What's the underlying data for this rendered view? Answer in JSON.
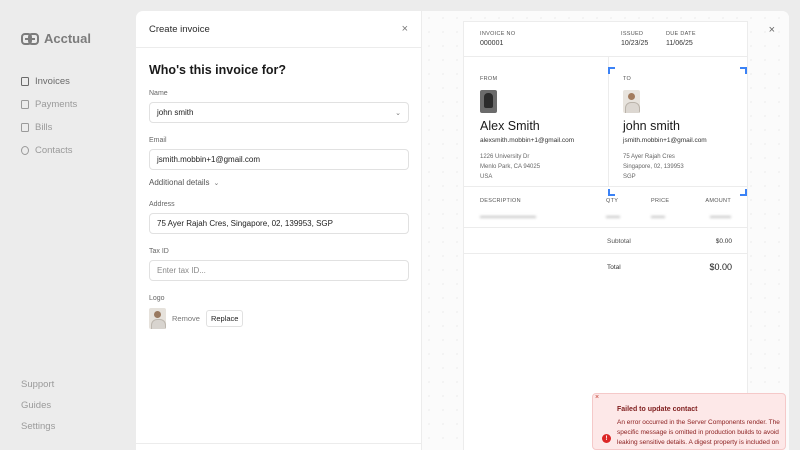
{
  "app": {
    "logo_text": "Acctual",
    "nav": [
      {
        "label": "Invoices",
        "icon": "document-icon",
        "active": true
      },
      {
        "label": "Payments",
        "icon": "wallet-icon",
        "active": false
      },
      {
        "label": "Bills",
        "icon": "bill-icon",
        "active": false
      },
      {
        "label": "Contacts",
        "icon": "contacts-icon",
        "active": false
      }
    ],
    "bottom_nav": [
      "Support",
      "Guides",
      "Settings"
    ]
  },
  "form": {
    "title": "Create invoice",
    "close": "×",
    "heading": "Who's this invoice for?",
    "name_label": "Name",
    "name_value": "john smith",
    "email_label": "Email",
    "email_value": "jsmith.mobbin+1@gmail.com",
    "additional_details": "Additional details",
    "address_label": "Address",
    "address_value": "75 Ayer Rajah Cres, Singapore, 02, 139953, SGP",
    "tax_label": "Tax ID",
    "tax_placeholder": "Enter tax ID...",
    "logo_label": "Logo",
    "remove_label": "Remove",
    "replace_label": "Replace"
  },
  "preview": {
    "close": "×",
    "invoice_no_label": "INVOICE NO",
    "invoice_no": "000001",
    "issued_label": "ISSUED",
    "issued": "10/23/25",
    "due_label": "DUE DATE",
    "due": "11/06/25",
    "from": {
      "label": "FROM",
      "name": "Alex Smith",
      "email": "alexsmith.mobbin+1@gmail.com",
      "address_line1": "1226 University Dr",
      "address_line2": "Menlo Park, CA 94025",
      "address_line3": "USA"
    },
    "to": {
      "label": "TO",
      "name": "john smith",
      "email": "jsmith.mobbin+1@gmail.com",
      "address_line1": "75 Ayer Rajah Cres",
      "address_line2": "Singapore, 02, 139953",
      "address_line3": "SGP"
    },
    "columns": {
      "description": "DESCRIPTION",
      "qty": "QTY",
      "price": "PRICE",
      "amount": "AMOUNT"
    },
    "subtotal_label": "Subtotal",
    "subtotal": "$0.00",
    "total_label": "Total",
    "total": "$0.00"
  },
  "toast": {
    "close": "×",
    "icon": "!",
    "title": "Failed to update contact",
    "body": "An error occurred in the Server Components render. The specific message is omitted in production builds to avoid leaking sensitive details. A digest property is included on this"
  },
  "colors": {
    "accent": "#3b82f6",
    "error": "#dc2626",
    "toast_bg": "#fde8e8"
  }
}
